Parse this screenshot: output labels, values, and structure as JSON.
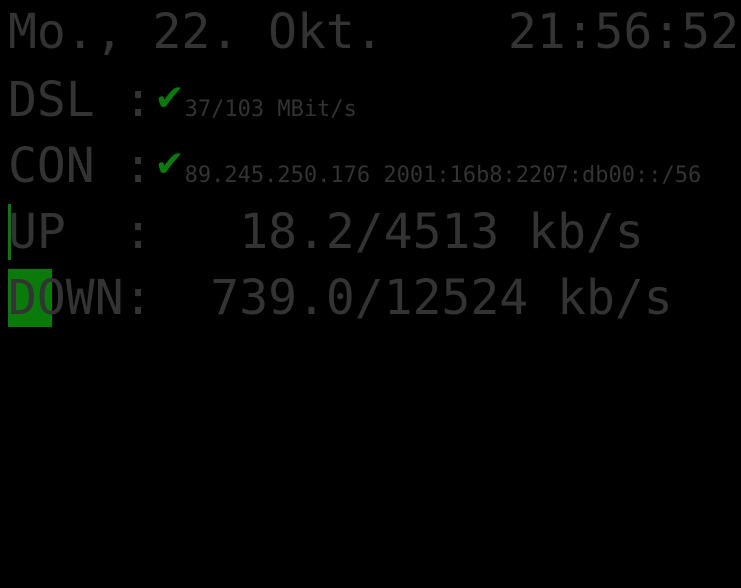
{
  "header": {
    "date": "Mo., 22. Okt.",
    "time": "21:56:52"
  },
  "status": {
    "dsl": {
      "label": "DSL :",
      "check_icon": "checkmark-icon",
      "value": "37/103 MBit/s"
    },
    "con": {
      "label": "CON :",
      "check_icon": "checkmark-icon",
      "value": "89.245.250.176 2001:16b8:2207:db00::/56"
    },
    "up": {
      "label": "UP  :",
      "value": "   18.2/4513 kb/s"
    },
    "down": {
      "label": "DOWN:",
      "value": "  739.0/12524 kb/s"
    }
  },
  "colors": {
    "background": "#000000",
    "text": "#333333",
    "accent_green": "#0a7a0a"
  }
}
